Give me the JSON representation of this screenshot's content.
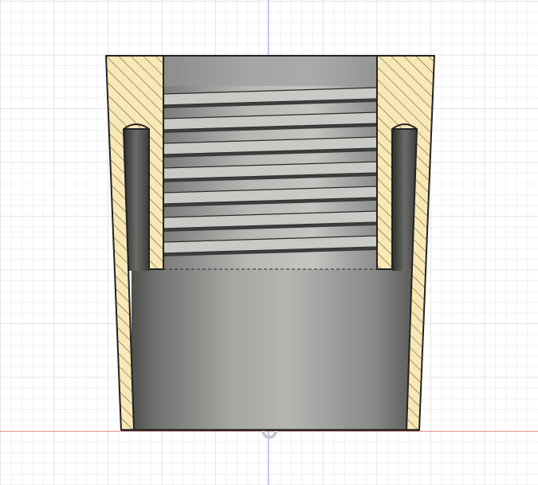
{
  "viewport": {
    "view_mode": "section-analysis",
    "model": "threaded-fitting-cross-section"
  },
  "colors": {
    "canvas_background": "#ffffff",
    "grid_minor": "#f1f1f1",
    "grid_major": "#e4e4e4",
    "x_axis": "#e98d8d",
    "y_axis": "#9fa6e6",
    "section_fill": "#f7e8b6",
    "hatch": "#5a4a2a",
    "body_grey": "#8d8d8b",
    "outline": "#222222"
  },
  "icons": {
    "origin_marker": "origin-icon"
  }
}
